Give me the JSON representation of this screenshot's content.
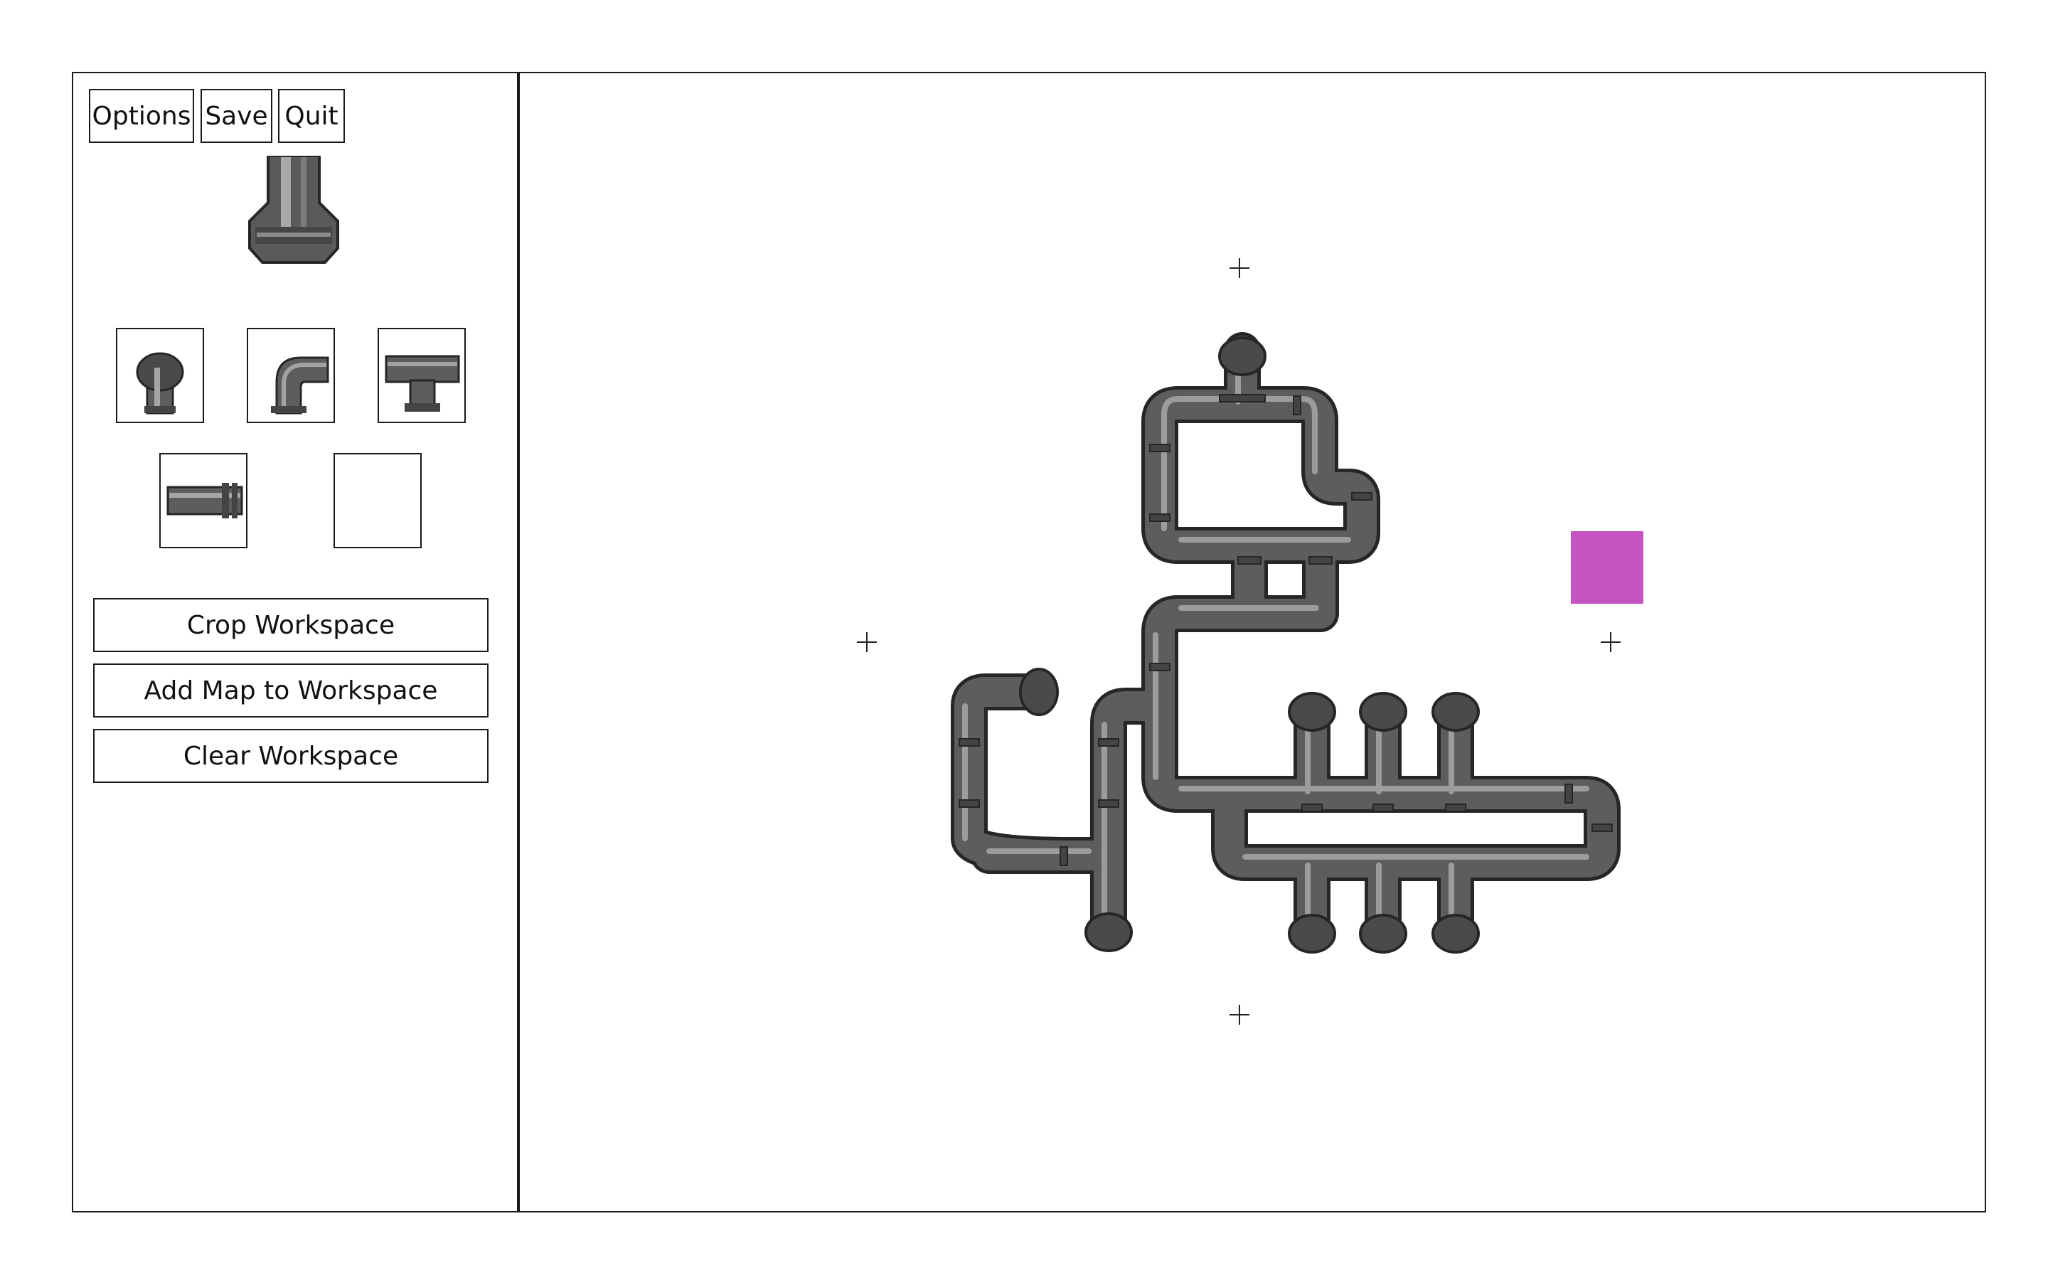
{
  "toolbar": {
    "options_label": "Options",
    "save_label": "Save",
    "quit_label": "Quit"
  },
  "preview": {
    "icon": "pipe-end-cap-icon"
  },
  "palette": {
    "tiles": [
      {
        "icon": "pipe-cap-icon"
      },
      {
        "icon": "pipe-elbow-icon"
      },
      {
        "icon": "pipe-tee-icon"
      },
      {
        "icon": "pipe-straight-icon"
      },
      {
        "icon": "empty-tile"
      }
    ]
  },
  "actions": {
    "crop_label": "Crop Workspace",
    "add_map_label": "Add Map to Workspace",
    "clear_label": "Clear Workspace"
  },
  "workspace": {
    "selection_color": "#c354c0",
    "pipe_color": "#5d5d5d",
    "pipe_outline": "#262626",
    "pipe_highlight": "#9a9a9a"
  }
}
